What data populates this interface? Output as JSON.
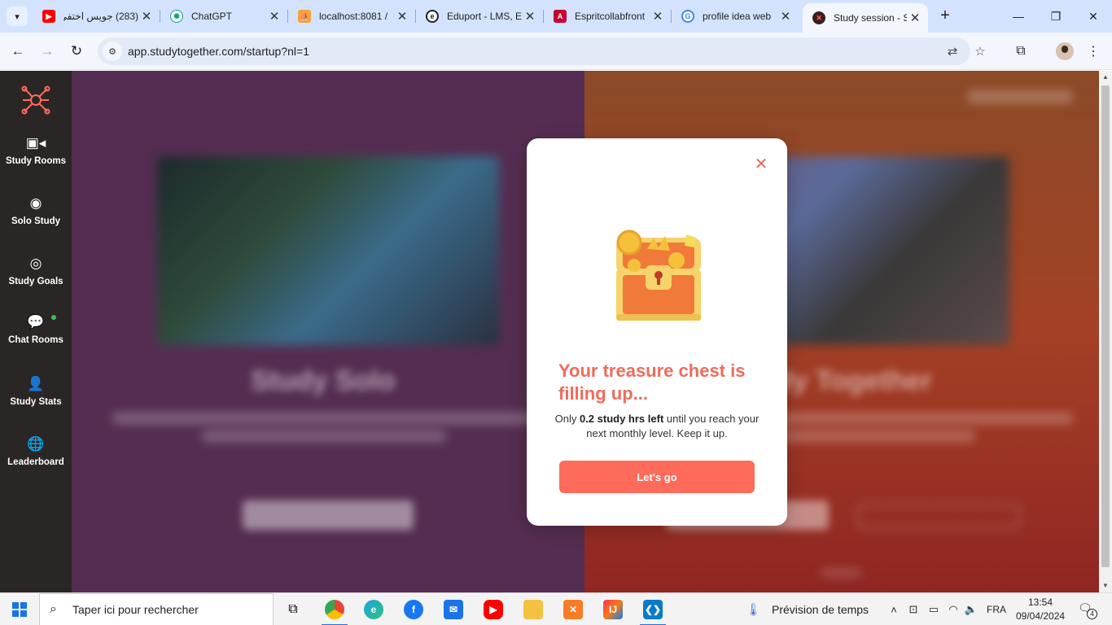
{
  "browser": {
    "tabs": [
      {
        "title": "(283) جويس اختفى",
        "favicon": "youtube-icon",
        "active": false
      },
      {
        "title": "ChatGPT",
        "favicon": "chatgpt-icon",
        "active": false
      },
      {
        "title": "localhost:8081 /",
        "favicon": "phpmyadmin-icon",
        "active": false
      },
      {
        "title": "Eduport - LMS, E",
        "favicon": "eduport-icon",
        "active": false
      },
      {
        "title": "Espritcollabfront",
        "favicon": "angular-icon",
        "active": false
      },
      {
        "title": "profile idea web",
        "favicon": "google-icon",
        "active": false
      },
      {
        "title": "Study session - S",
        "favicon": "studytogether-icon",
        "active": true
      }
    ],
    "new_tab": "+",
    "url": "app.studytogether.com/startup?nl=1",
    "colors": {
      "tab_strip": "#d3e3fd",
      "toolbar": "#f3f6fc"
    }
  },
  "sidebar": {
    "items": [
      {
        "label": "Study Rooms",
        "icon": "video-camera-icon"
      },
      {
        "label": "Solo Study",
        "icon": "solo-study-icon"
      },
      {
        "label": "Study Goals",
        "icon": "target-icon"
      },
      {
        "label": "Chat Rooms",
        "icon": "chat-bubbles-icon"
      },
      {
        "label": "Study Stats",
        "icon": "person-icon"
      },
      {
        "label": "Leaderboard",
        "icon": "globe-icon"
      }
    ],
    "colors": {
      "background": "#2a2625",
      "online": "#3fbf5a"
    }
  },
  "background": {
    "left_heading": "Study Solo",
    "right_heading": "Study Together",
    "colors": {
      "left": "#552d52",
      "right": "#a44025"
    }
  },
  "modal": {
    "title": "Your treasure chest is filling up...",
    "message_prefix": "Only ",
    "message_bold": "0.2 study hrs left",
    "message_suffix": " until you reach your next monthly level. Keep it up.",
    "button": "Let's go",
    "icon": "treasure-chest-icon",
    "colors": {
      "title": "#f06b5b",
      "button": "#ff6b5b"
    }
  },
  "taskbar": {
    "search_placeholder": "Taper ici pour rechercher",
    "weather": "Prévision de temps",
    "language": "FRA",
    "time": "13:54",
    "date": "09/04/2024",
    "notifications": "4"
  }
}
